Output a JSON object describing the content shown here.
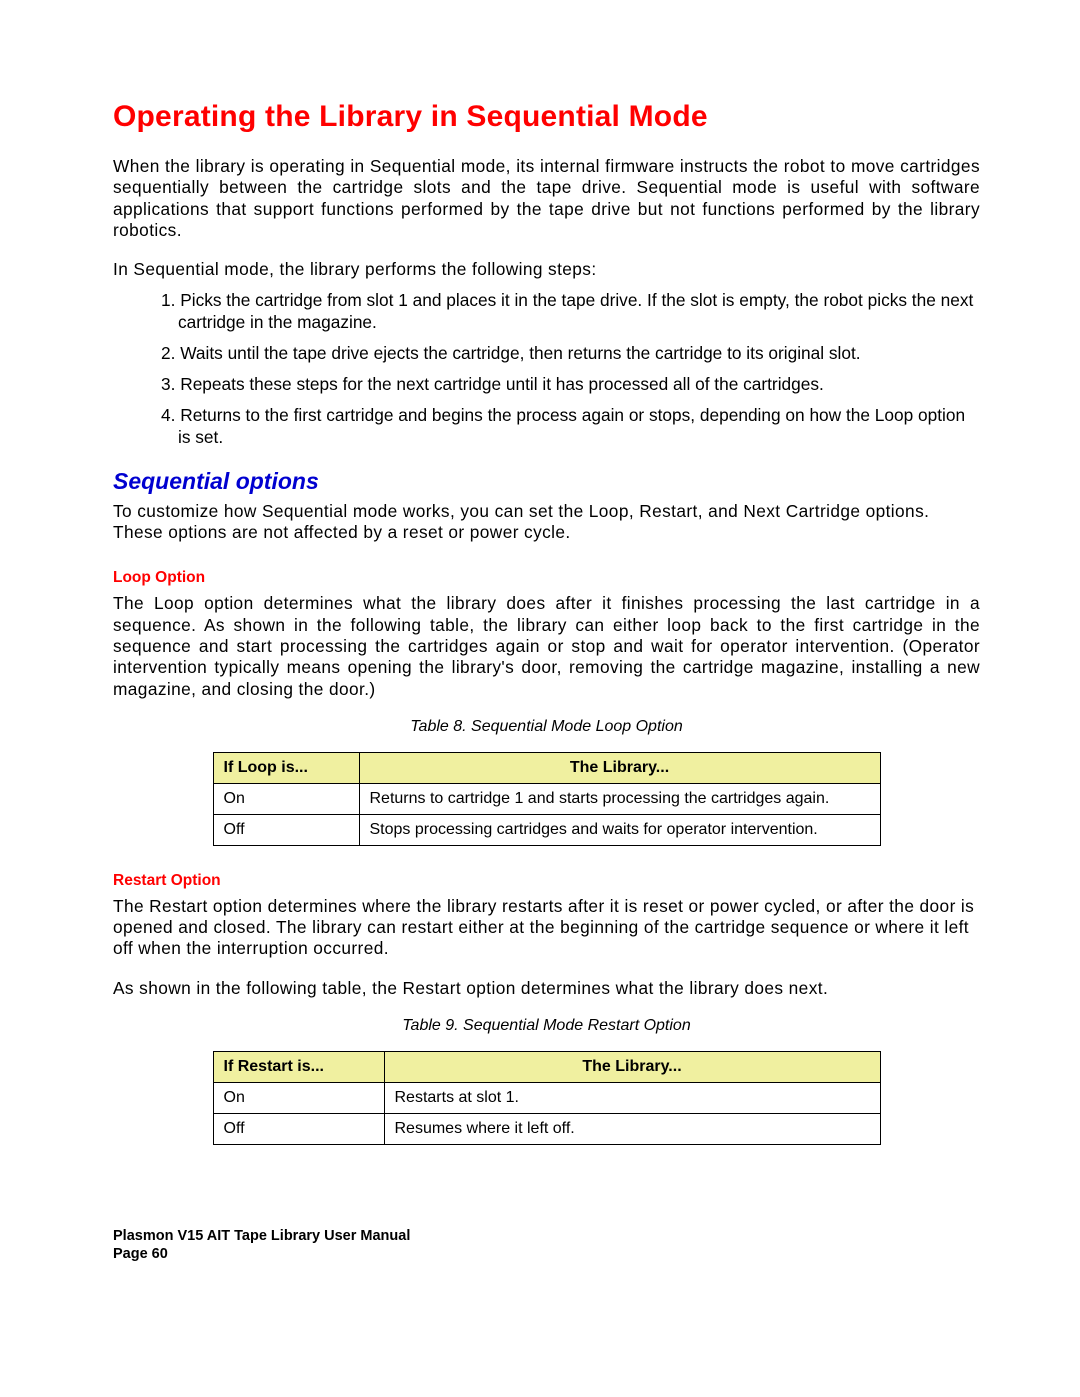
{
  "title": "Operating the Library in Sequential Mode",
  "intro_p1": "When the library is operating in Sequential mode, its internal firmware instructs the robot to move cartridges sequentially between the cartridge slots and the tape drive. Sequential mode is useful with software applications that support functions performed by the tape drive but not functions performed by the library robotics.",
  "intro_p2": "In Sequential mode, the library performs the following steps:",
  "steps": [
    "1. Picks the cartridge from slot 1 and places it in the tape drive. If the slot is empty, the robot picks the next cartridge in the magazine.",
    "2. Waits until the tape drive ejects the cartridge, then returns the cartridge to its original slot.",
    "3. Repeats these steps for the next cartridge until it has processed all of the cartridges.",
    "4. Returns to the first cartridge and begins the process again or stops, depending on how the Loop option is set."
  ],
  "seq_heading": "Sequential options",
  "seq_intro": "To customize how Sequential mode works, you can set the Loop, Restart, and Next Cartridge options. These options are not affected by a reset or power cycle.",
  "loop_heading": "Loop Option",
  "loop_text": "The Loop option determines what the library does after it finishes processing the last cartridge in a sequence. As shown in the following table, the library can either loop back to the first cartridge in the sequence and start processing the cartridges again or stop and wait for operator intervention. (Operator intervention typically means opening the library's door, removing the cartridge magazine, installing a new magazine, and closing the door.)",
  "table8_caption": "Table 8. Sequential Mode Loop Option",
  "table8": {
    "h1": "If Loop is...",
    "h2": "The Library...",
    "rows": [
      {
        "c1": "On",
        "c2": "Returns to cartridge 1 and starts processing the cartridges again."
      },
      {
        "c1": "Off",
        "c2": "Stops processing cartridges and waits for operator intervention."
      }
    ]
  },
  "restart_heading": "Restart Option",
  "restart_text1": "The Restart option determines where the library restarts after it is reset or power cycled, or after the door is opened and closed. The library can restart either at the beginning of the cartridge sequence or where it left off when the interruption occurred.",
  "restart_text2": "As shown in the following table, the Restart option determines what the library does next.",
  "table9_caption": "Table 9. Sequential Mode Restart Option",
  "table9": {
    "h1": "If Restart is...",
    "h2": "The Library...",
    "rows": [
      {
        "c1": "On",
        "c2": "Restarts at slot 1."
      },
      {
        "c1": "Off",
        "c2": "Resumes where it left off."
      }
    ]
  },
  "footer_line1": "Plasmon V15 AIT Tape Library User Manual",
  "footer_line2": "Page 60"
}
